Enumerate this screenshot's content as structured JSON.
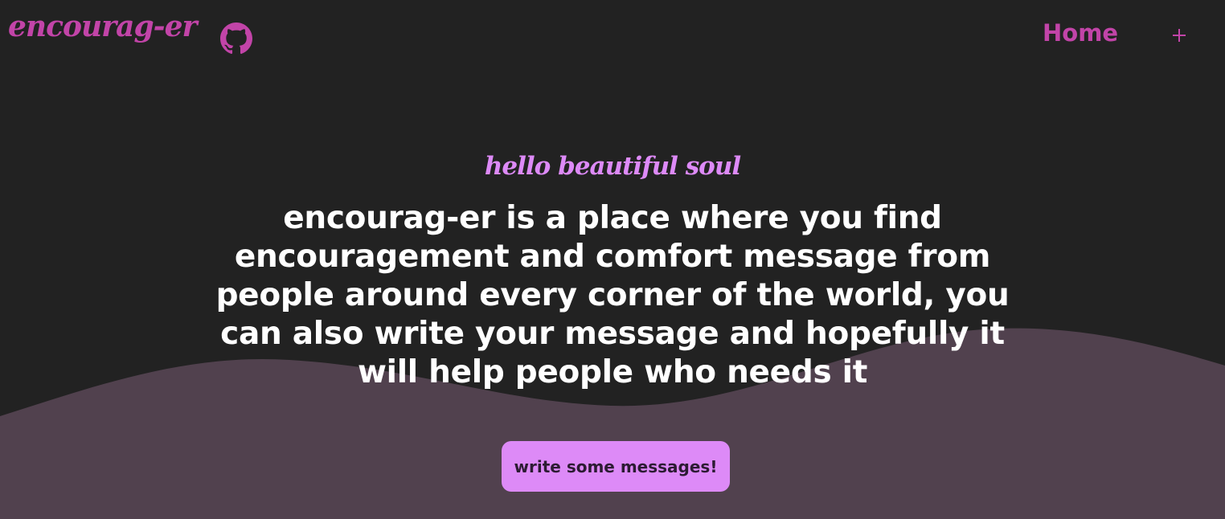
{
  "nav": {
    "brand": "encourag-er",
    "github_icon": "github-icon",
    "home_label": "Home",
    "add_icon": "plus-icon"
  },
  "hero": {
    "greeting": "hello beautiful soul",
    "intro": "encourag-er is a place where you find encouragement and comfort message from people around every corner of the world, you can also write your message and hopefully it will help people who needs it",
    "cta_label": "write some messages!"
  },
  "colors": {
    "background": "#222222",
    "wave": "#51414e",
    "accent": "#c244a8",
    "light_accent": "#dd8af7",
    "text": "#ffffff"
  }
}
